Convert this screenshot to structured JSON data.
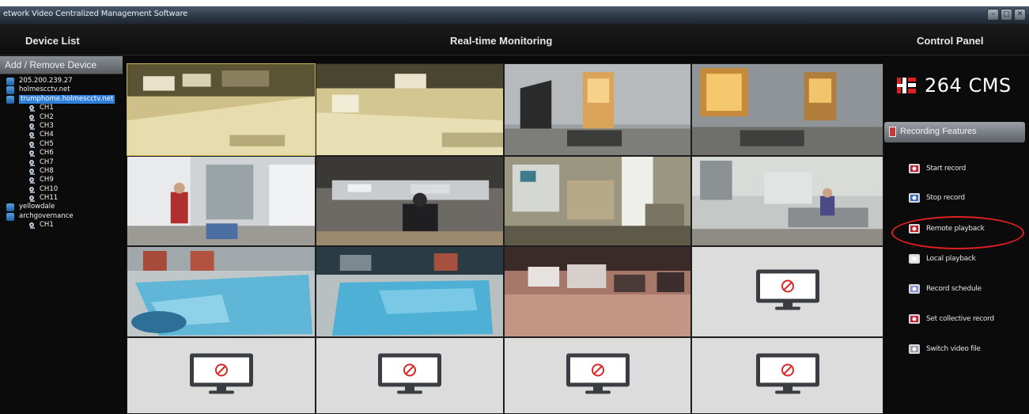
{
  "window": {
    "title": "etwork Video Centralized Management Software",
    "buttons": [
      "–",
      "□",
      "✕"
    ]
  },
  "header": {
    "left": "Device List",
    "center": "Real-time Monitoring",
    "right": "Control Panel"
  },
  "device_list": {
    "add_remove_label": "Add / Remove Device",
    "tree": [
      {
        "type": "device",
        "label": "205.200.239.27"
      },
      {
        "type": "device",
        "label": "holmescctv.net"
      },
      {
        "type": "device",
        "label": "trumphome.holmescctv.net",
        "selected": true
      },
      {
        "type": "channel",
        "label": "CH1"
      },
      {
        "type": "channel",
        "label": "CH2"
      },
      {
        "type": "channel",
        "label": "CH3"
      },
      {
        "type": "channel",
        "label": "CH4"
      },
      {
        "type": "channel",
        "label": "CH5"
      },
      {
        "type": "channel",
        "label": "CH6"
      },
      {
        "type": "channel",
        "label": "CH7"
      },
      {
        "type": "channel",
        "label": "CH8"
      },
      {
        "type": "channel",
        "label": "CH9"
      },
      {
        "type": "channel",
        "label": "CH10"
      },
      {
        "type": "channel",
        "label": "CH11"
      },
      {
        "type": "device",
        "label": "yellowdale"
      },
      {
        "type": "device",
        "label": "archgovernance"
      },
      {
        "type": "channel",
        "label": "CH1"
      }
    ]
  },
  "video_grid": {
    "cells": [
      {
        "scene": "snowy-parking-night",
        "active": true
      },
      {
        "scene": "snowy-parking-night-2"
      },
      {
        "scene": "doorway-interior"
      },
      {
        "scene": "lobby-door"
      },
      {
        "scene": "office-interior-person"
      },
      {
        "scene": "kitchen-person"
      },
      {
        "scene": "storage-room"
      },
      {
        "scene": "office-desk"
      },
      {
        "scene": "indoor-pool"
      },
      {
        "scene": "indoor-pool-2"
      },
      {
        "scene": "parking-lot-cars"
      },
      {
        "scene": "no-signal"
      },
      {
        "scene": "no-signal"
      },
      {
        "scene": "no-signal"
      },
      {
        "scene": "no-signal"
      },
      {
        "scene": "no-signal"
      }
    ]
  },
  "control_panel": {
    "brand": "264 CMS",
    "section_label": "Recording Features",
    "items": [
      {
        "label": "Start record",
        "icon": "start-record-icon"
      },
      {
        "label": "Stop record",
        "icon": "stop-record-icon"
      },
      {
        "label": "Remote playback",
        "icon": "remote-playback-icon",
        "highlighted": true
      },
      {
        "label": "Local playback",
        "icon": "local-playback-icon"
      },
      {
        "label": "Record schedule",
        "icon": "record-schedule-icon"
      },
      {
        "label": "Set collective record",
        "icon": "collective-record-icon"
      },
      {
        "label": "Switch video file",
        "icon": "switch-video-file-icon"
      }
    ]
  },
  "colors": {
    "background": "#0a0a0a",
    "selection": "#2f7fdc",
    "highlight_oval": "#e02020",
    "active_cell_border": "#c9b54a"
  }
}
